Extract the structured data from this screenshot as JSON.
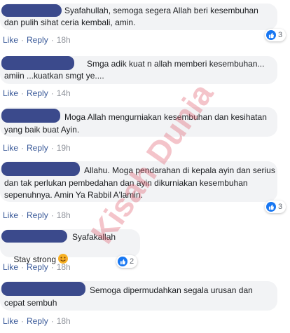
{
  "colors": {
    "bubble_bg": "#f2f3f5",
    "link": "#385898",
    "meta": "#90949c",
    "like_blue": "#1877f2",
    "redaction": "#3b4a8c",
    "watermark": "#e05a6a"
  },
  "actions": {
    "like": "Like",
    "reply": "Reply",
    "sep": "·"
  },
  "comments": [
    {
      "lines": [
        "Syafahullah, semoga segera Allah beri kesembuhan",
        "dan pulih sihat ceria kembali, amin."
      ],
      "time": "18h",
      "reactions": "3"
    },
    {
      "lines": [
        "Smga adik kuat n allah memberi kesembuhan...",
        "amiin ...kuatkan smgt ye...."
      ],
      "time": "14h",
      "reactions": ""
    },
    {
      "lines": [
        "Moga Allah mengurniakan kesembuhan dan kesihatan",
        "yang baik buat Ayin."
      ],
      "time": "19h",
      "reactions": ""
    },
    {
      "lines": [
        "Allahu. Moga pendarahan di kepala ayin dan serius",
        "dan tak perlukan pembedahan dan ayin dikurniakan kesembuhan",
        "sepenuhnya. Amin Ya Rabbil A'lamin."
      ],
      "time": "18h",
      "reactions": "3"
    },
    {
      "lines": [
        "Syafakallah",
        "Stay strong"
      ],
      "time": "18h",
      "reactions": "2"
    },
    {
      "lines": [
        "Semoga dipermudahkan segala urusan dan",
        "cepat sembuh"
      ],
      "time": "18h",
      "reactions": ""
    }
  ],
  "watermark": {
    "text": "Kisah Dunia"
  }
}
